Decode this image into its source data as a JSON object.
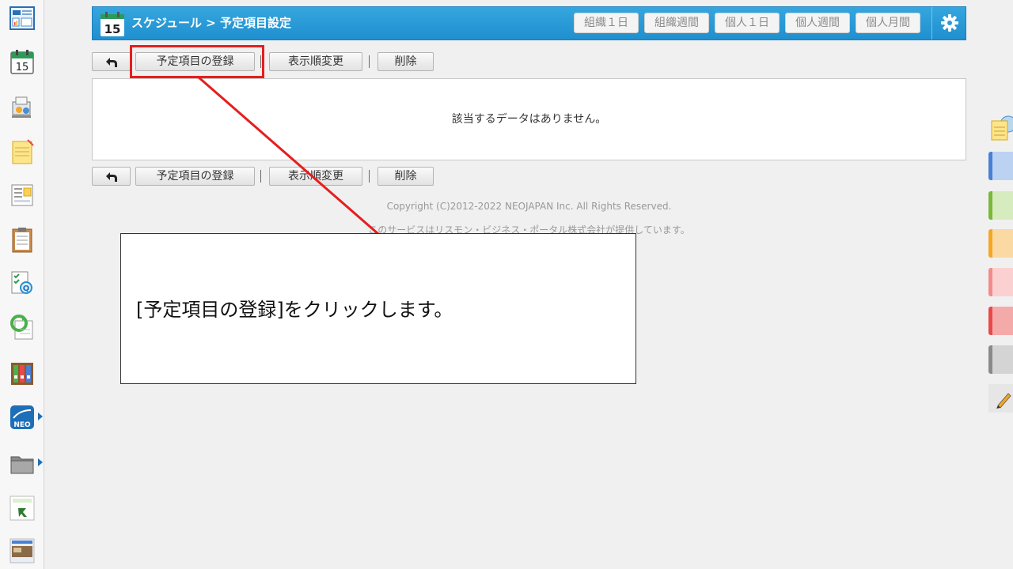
{
  "header": {
    "calendar_day": "15",
    "title": "スケジュール > 予定項目設定",
    "views": [
      "組織１日",
      "組織週間",
      "個人１日",
      "個人週間",
      "個人月間"
    ]
  },
  "sidebar": {
    "calendar_day": "15",
    "items": [
      "portal",
      "schedule",
      "facility-reservation",
      "memo",
      "bulletin-board",
      "documents",
      "workflow",
      "timecard",
      "cabinet",
      "neo-app",
      "folder",
      "tanomeru",
      "banner"
    ]
  },
  "toolbar": {
    "back": "←",
    "register": "予定項目の登録",
    "reorder": "表示順変更",
    "delete": "削除"
  },
  "main": {
    "empty_message": "該当するデータはありません。"
  },
  "footer": {
    "copyright": "Copyright (C)2012-2022 NEOJAPAN Inc. All Rights Reserved.",
    "provider": "このサービスはリスモン・ビジネス・ポータル株式会社が提供しています。"
  },
  "annotation": {
    "instruction": "[予定項目の登録]をクリックします。",
    "color": "#e51e1e"
  },
  "colors": {
    "header": "#2a9bd8",
    "palette": [
      "#4a7fd6",
      "#7ab83a",
      "#f5a623",
      "#f28b8b",
      "#e84a4a",
      "#8a8a8a"
    ]
  }
}
